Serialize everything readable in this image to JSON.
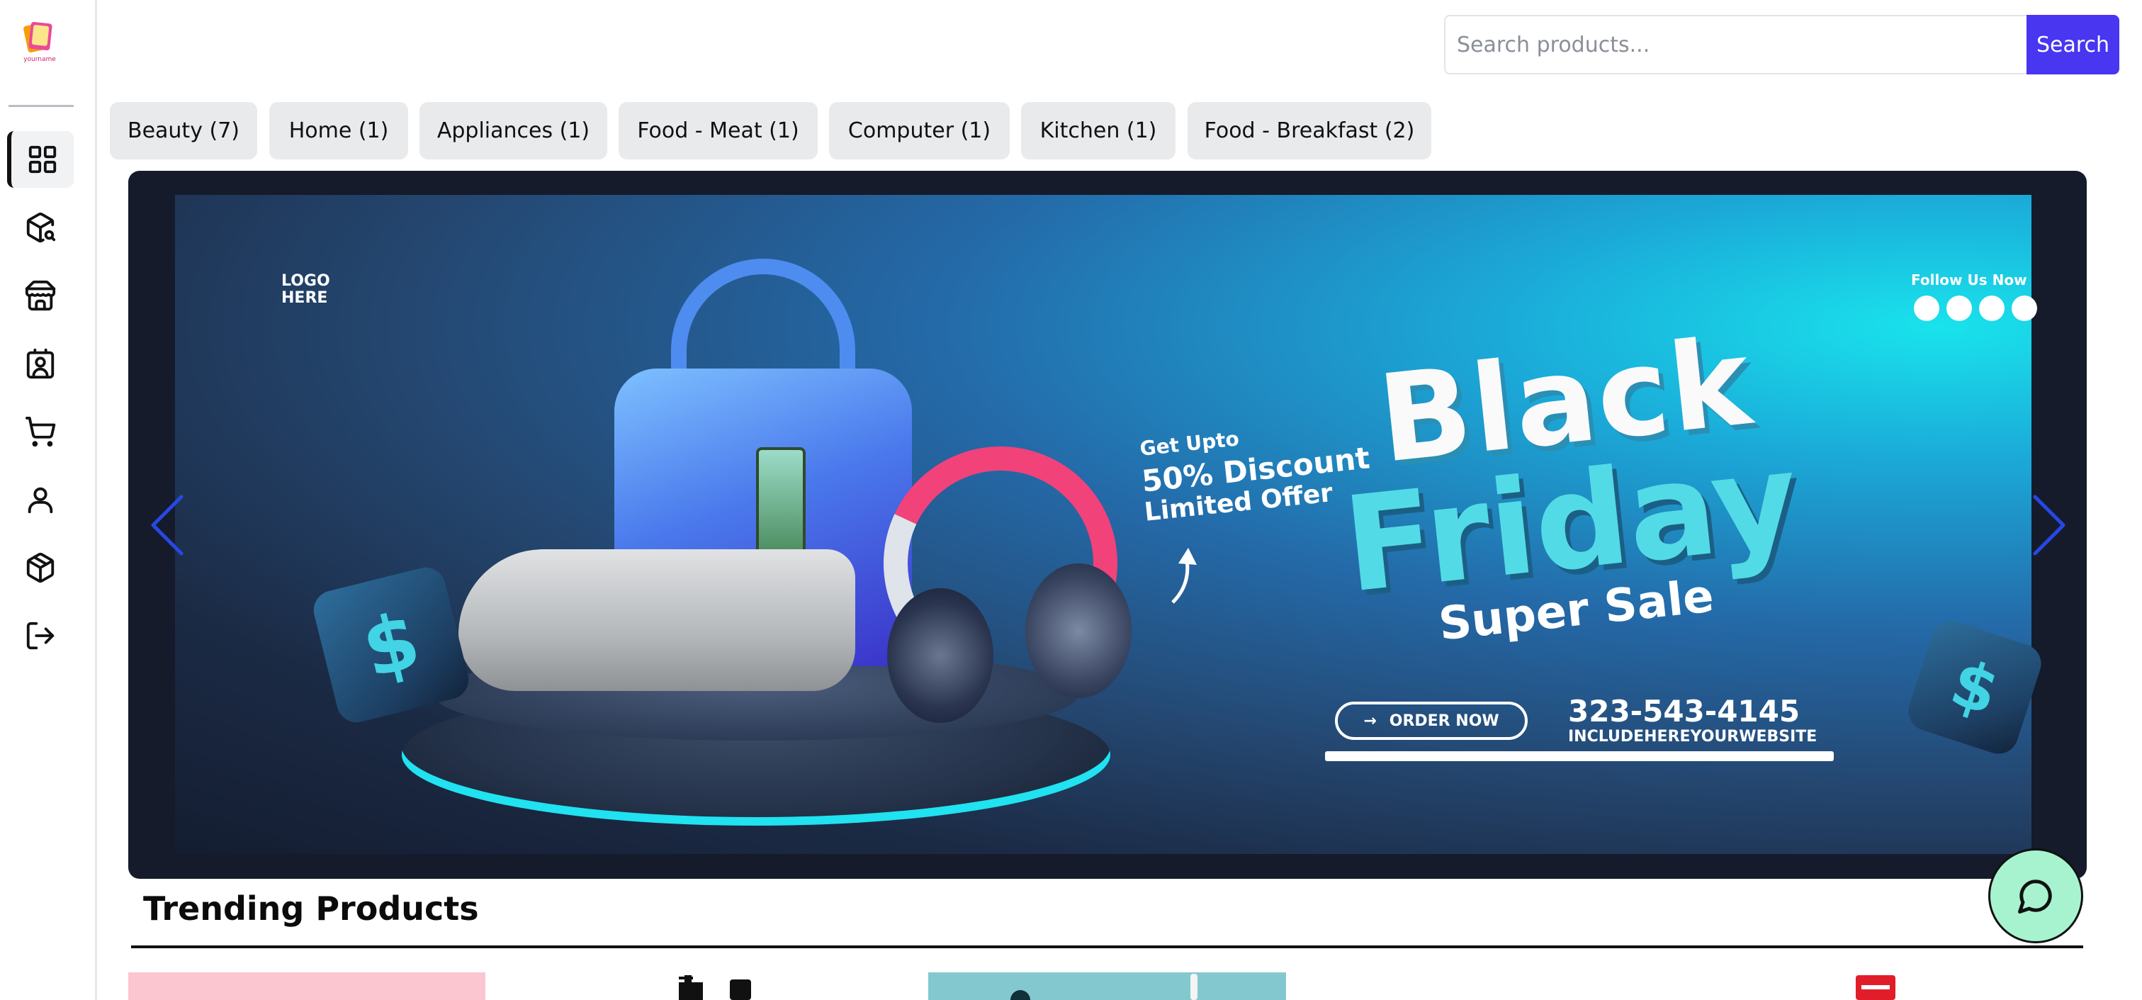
{
  "sidebar": {
    "logo": "yourname",
    "items": [
      {
        "name": "dashboard",
        "icon": "grid-icon",
        "active": true
      },
      {
        "name": "product-search",
        "icon": "package-search-icon",
        "active": false
      },
      {
        "name": "store",
        "icon": "store-icon",
        "active": false
      },
      {
        "name": "contacts",
        "icon": "contact-card-icon",
        "active": false
      },
      {
        "name": "cart",
        "icon": "cart-icon",
        "active": false
      },
      {
        "name": "profile",
        "icon": "user-icon",
        "active": false
      },
      {
        "name": "orders",
        "icon": "box-icon",
        "active": false
      },
      {
        "name": "logout",
        "icon": "logout-icon",
        "active": false
      }
    ]
  },
  "search": {
    "placeholder": "Search products...",
    "value": "",
    "button_label": "Search"
  },
  "categories": [
    {
      "label": "Beauty (7)"
    },
    {
      "label": "Home (1)"
    },
    {
      "label": "Appliances (1)"
    },
    {
      "label": "Food - Meat (1)"
    },
    {
      "label": "Computer (1)"
    },
    {
      "label": "Kitchen (1)"
    },
    {
      "label": "Food - Breakfast (2)"
    }
  ],
  "banner": {
    "logo_text_1": "LOGO",
    "logo_text_2": "HERE",
    "follow": "Follow Us Now",
    "get_upto": "Get Upto",
    "discount": "50% Discount",
    "limited": "Limited Offer",
    "headline_1": "Black",
    "headline_2": "Friday",
    "headline_3": "Super Sale",
    "order_button": "ORDER NOW",
    "phone": "323-543-4145",
    "website": "INCLUDEHEREYOURWEBSITE",
    "dice_symbol": "$"
  },
  "colors": {
    "accent": "#4836f0",
    "chat_fab": "#a7f3d0",
    "carousel_arrow": "#2748e6"
  },
  "trending": {
    "title": "Trending Products"
  }
}
